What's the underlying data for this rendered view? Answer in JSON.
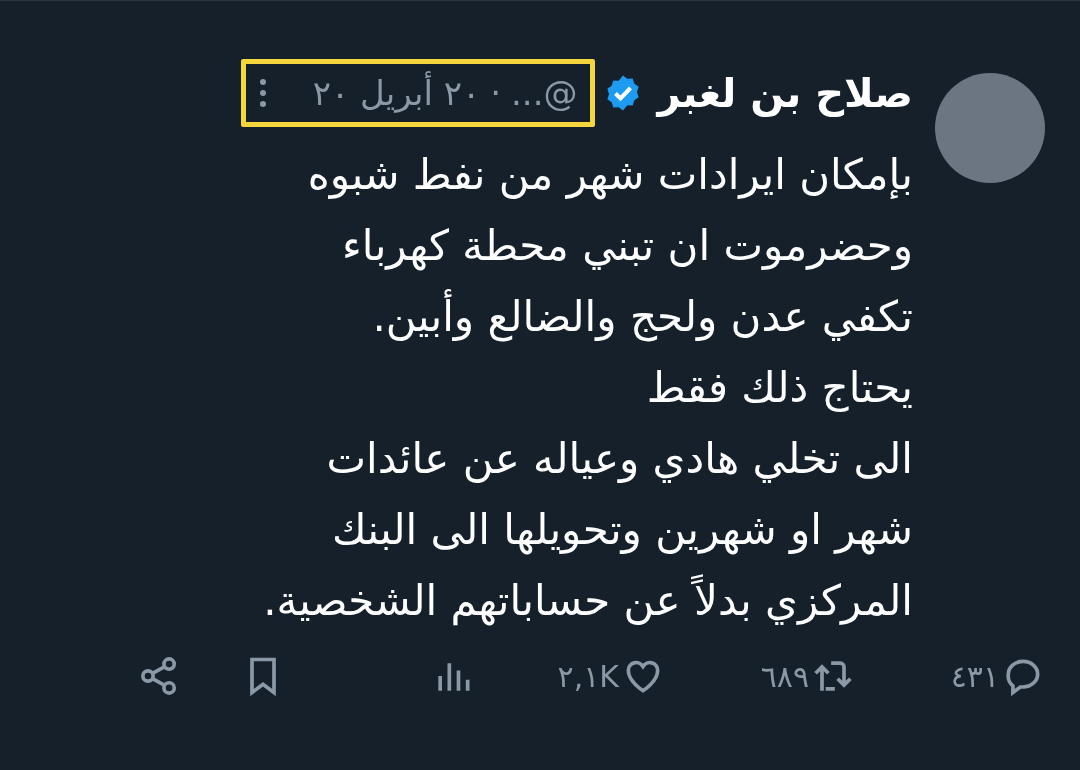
{
  "tweet": {
    "author": {
      "name": "صلاح بن لغبر",
      "verified": true,
      "handle": "@...",
      "separator": "·",
      "date": "٢٠ أبريل ٢٠",
      "highlighted": true
    },
    "text": "بإمكان ايرادات شهر من نفط شبوه\nوحضرموت ان تبني محطة كهرباء\nتكفي عدن ولحج والضالع وأبين.\nيحتاج ذلك فقط\nالى تخلي هادي وعياله عن عائدات\nشهر او شهرين وتحويلها الى البنك\nالمركزي بدلاً عن حساباتهم الشخصية.",
    "actions": [
      {
        "kind": "reply",
        "count": "٤٣١"
      },
      {
        "kind": "retweet",
        "count": "٦٨٩"
      },
      {
        "kind": "like",
        "count": "٢,١K"
      },
      {
        "kind": "views"
      },
      {
        "kind": "bookmark"
      },
      {
        "kind": "share"
      }
    ]
  }
}
